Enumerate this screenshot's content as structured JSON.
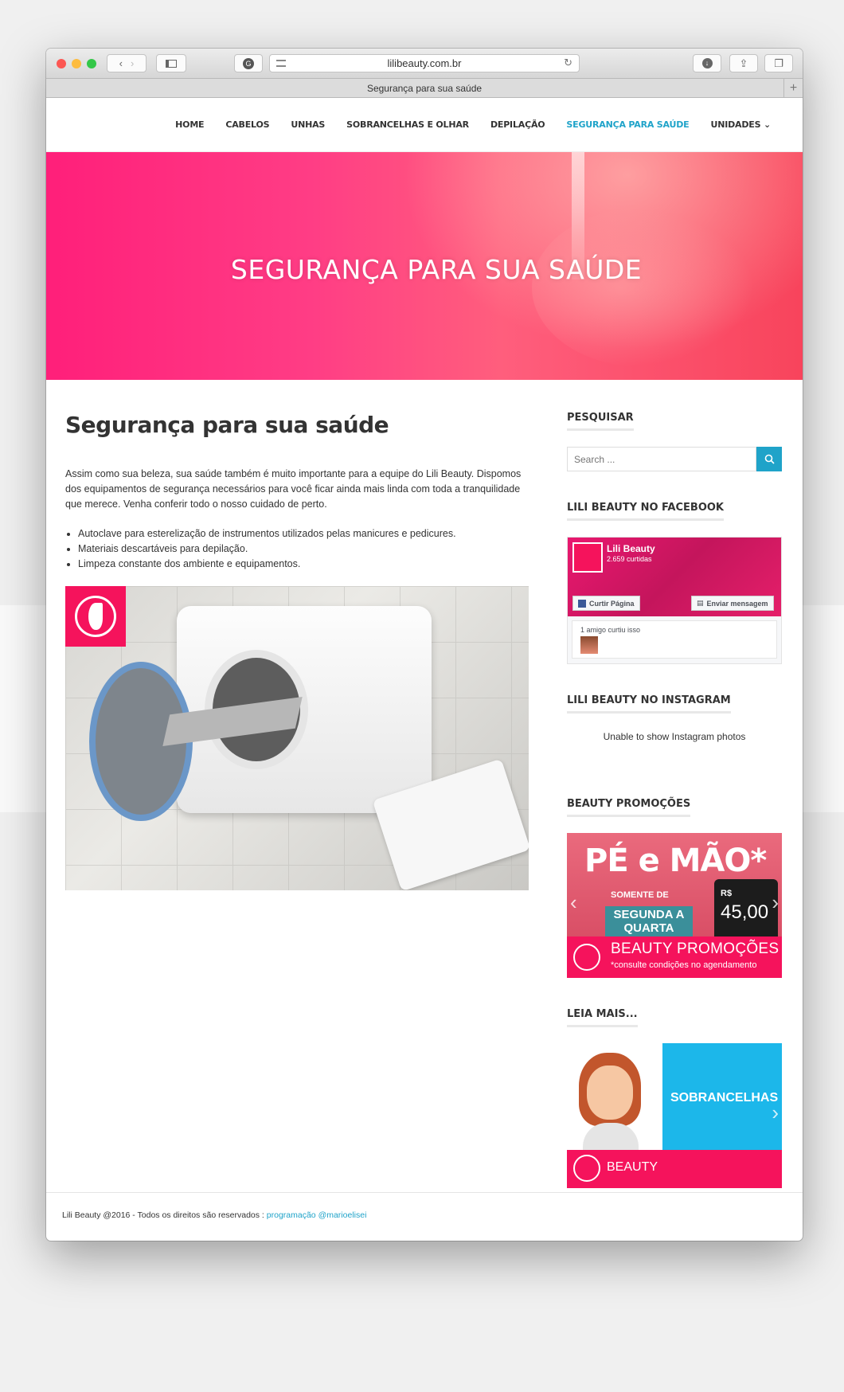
{
  "browser": {
    "url": "lilibeauty.com.br",
    "tab_title": "Segurança para sua saúde",
    "colors": {
      "close": "#fc5753",
      "minimize": "#fdbc40",
      "zoom": "#33c748"
    }
  },
  "nav": {
    "items": [
      "HOME",
      "CABELOS",
      "UNHAS",
      "SOBRANCELHAS E OLHAR",
      "DEPILAÇÃO",
      "SEGURANÇA PARA SAÚDE",
      "UNIDADES"
    ],
    "active": "SEGURANÇA PARA SAÚDE",
    "dropdown_icon": "chevron-down-icon"
  },
  "hero": {
    "title": "SEGURANÇA PARA SUA SAÚDE"
  },
  "article": {
    "title": "Segurança para sua saúde",
    "intro": "Assim como sua beleza, sua saúde também é muito importante para a equipe do Lili Beauty. Dispomos dos equipamentos de segurança necessários para você ficar ainda mais linda com toda a tranquilidade que merece. Venha conferir todo o nosso cuidado de perto.",
    "bullets": [
      "Autoclave para esterelização de instrumentos utilizados pelas manicures e pedicures.",
      "Materiais descartáveis para depilação.",
      "Limpeza constante dos ambiente e equipamentos."
    ]
  },
  "sidebar": {
    "search": {
      "title": "PESQUISAR",
      "placeholder": "Search ..."
    },
    "facebook": {
      "title": "LILI BEAUTY NO FACEBOOK",
      "page_name": "Lili Beauty",
      "likes": "2.659 curtidas",
      "like_button": "Curtir Página",
      "message_button": "Enviar mensagem",
      "friends": "1 amigo curtiu isso"
    },
    "instagram": {
      "title": "LILI BEAUTY NO INSTAGRAM",
      "message": "Unable to show Instagram photos"
    },
    "promo": {
      "title": "BEAUTY PROMOÇÕES",
      "headline": "PÉ e MÃO*",
      "somente": "SOMENTE DE",
      "days": "SEGUNDA A QUARTA",
      "currency": "R$",
      "price": "45,00",
      "banner_title": "BEAUTY PROMOÇÕES",
      "banner_sub": "*consulte condições no agendamento"
    },
    "leia": {
      "title": "LEIA MAIS...",
      "slide_word": "SOBRANCELHAS",
      "banner_title": "BEAUTY"
    }
  },
  "footer": {
    "text": "Lili Beauty @2016 - Todos os direitos são reservados : ",
    "link": "programação @marioelisei"
  },
  "accent": "#1fa3c9",
  "brand": "#f5135c"
}
